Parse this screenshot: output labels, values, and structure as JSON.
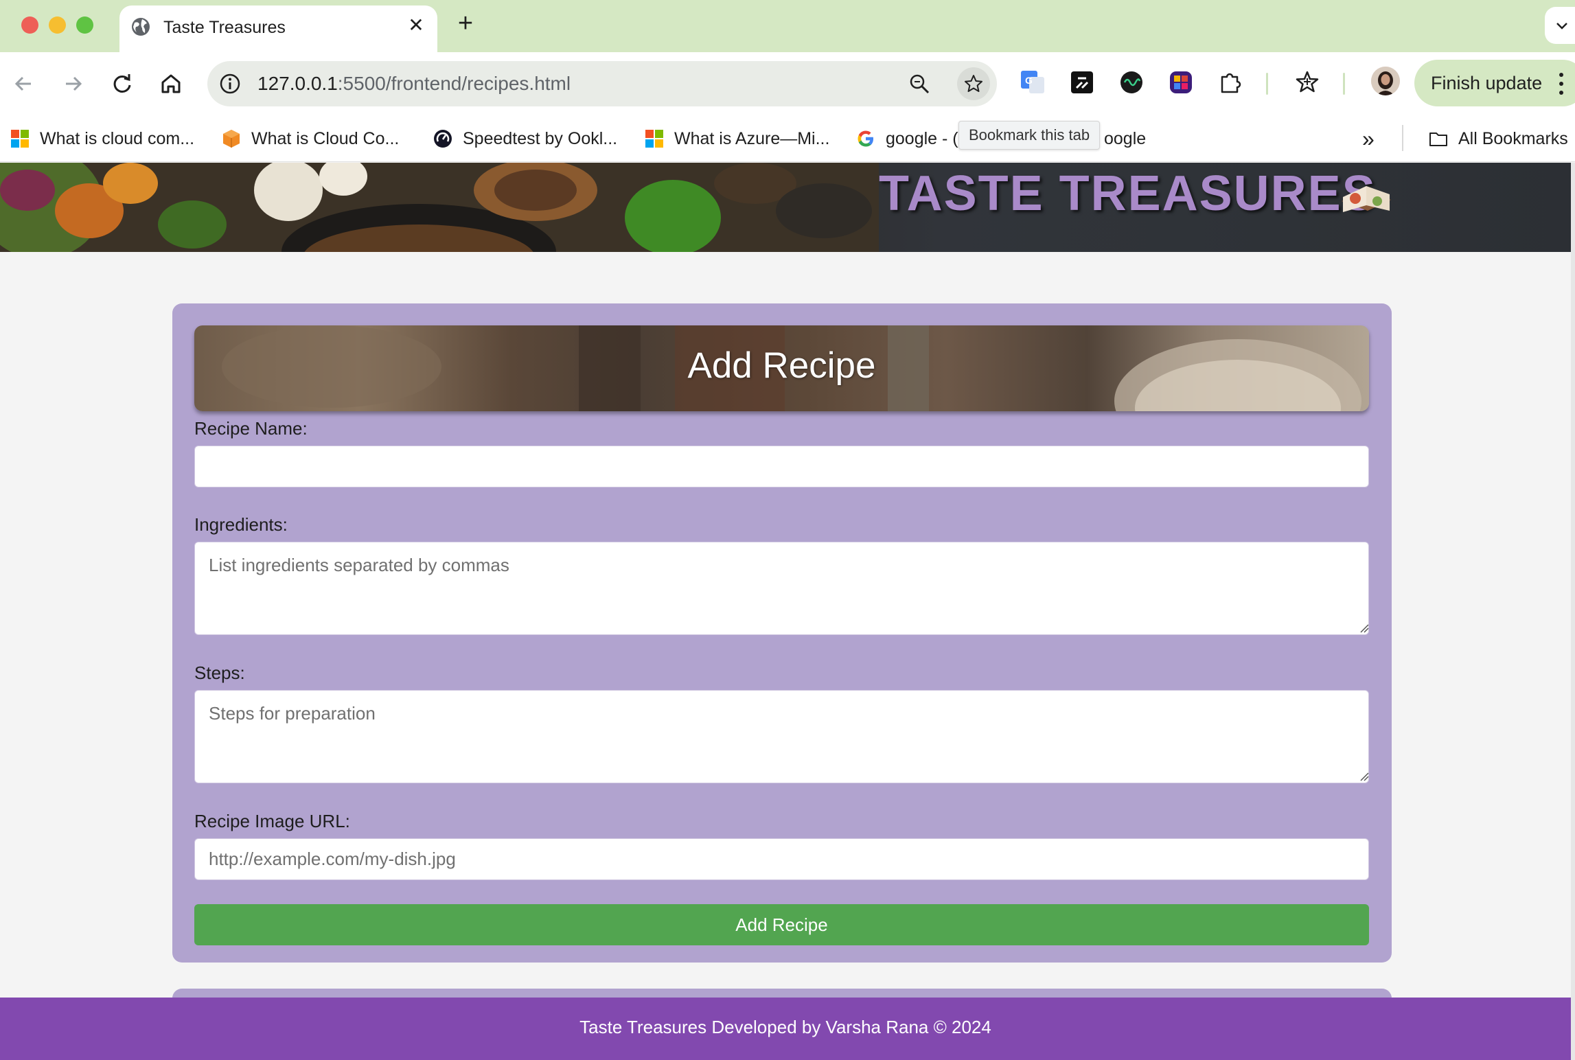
{
  "browser": {
    "tab_title": "Taste Treasures",
    "new_tab_label": "+",
    "close_tab_label": "✕",
    "url_host": "127.0.0.1",
    "url_path": ":5500/frontend/recipes.html",
    "finish_update_label": "Finish update",
    "tooltip": "Bookmark this tab",
    "bookmarks": [
      {
        "label": "What is cloud com...",
        "icon": "microsoft-icon"
      },
      {
        "label": "What is Cloud Co...",
        "icon": "aws-cube-icon"
      },
      {
        "label": "Speedtest by Ookl...",
        "icon": "speedtest-icon"
      },
      {
        "label": "What is Azure—Mi...",
        "icon": "microsoft-icon"
      },
      {
        "label": "google - (",
        "icon": "google-icon"
      },
      {
        "label": "oogle",
        "icon": ""
      }
    ],
    "overflow_label": "»",
    "all_bookmarks_label": "All Bookmarks",
    "colors": {
      "tab_strip": "#d5e8c3",
      "toolbar": "#ffffff"
    }
  },
  "page": {
    "brand": "TASTE TREASURES",
    "form": {
      "title": "Add Recipe",
      "name_label": "Recipe Name:",
      "name_value": "",
      "ingredients_label": "Ingredients:",
      "ingredients_placeholder": "List ingredients separated by commas",
      "steps_label": "Steps:",
      "steps_placeholder": "Steps for preparation",
      "image_label": "Recipe Image URL:",
      "image_placeholder": "http://example.com/my-dish.jpg",
      "submit_label": "Add Recipe"
    },
    "footer_text": "Taste Treasures Developed by Varsha Rana © 2024",
    "colors": {
      "card": "#b1a3cf",
      "button": "#52a550",
      "footer": "#8249af",
      "brand_text": "#a98ac9"
    }
  }
}
